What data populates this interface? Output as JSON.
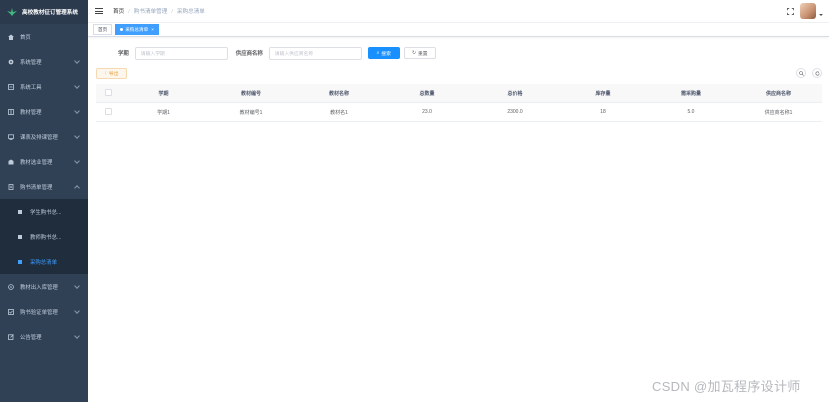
{
  "app": {
    "title": "高校教材征订管理系统"
  },
  "sidebar": {
    "items": [
      {
        "label": "首页",
        "icon": "home-icon"
      },
      {
        "label": "系统管理",
        "icon": "gear-icon",
        "expandable": true
      },
      {
        "label": "系统工具",
        "icon": "tool-icon",
        "expandable": true
      },
      {
        "label": "教材管理",
        "icon": "book-icon",
        "expandable": true
      },
      {
        "label": "课表及排课管理",
        "icon": "monitor-icon",
        "expandable": true
      },
      {
        "label": "教材选业管理",
        "icon": "building-icon",
        "expandable": true
      },
      {
        "label": "购书清单管理",
        "icon": "document-icon",
        "expandable": true,
        "expanded": true
      }
    ],
    "subitems": [
      {
        "label": "学生购书总...",
        "active": false
      },
      {
        "label": "教师购书总...",
        "active": false
      },
      {
        "label": "采购总清单",
        "active": true
      }
    ],
    "items_after": [
      {
        "label": "教材出入库管理",
        "icon": "warehouse-icon",
        "expandable": true
      },
      {
        "label": "购书验证单管理",
        "icon": "check-icon",
        "expandable": true
      },
      {
        "label": "公告管理",
        "icon": "edit-icon",
        "expandable": true
      }
    ]
  },
  "breadcrumb": {
    "home": "首页",
    "parent": "购书清单管理",
    "current": "采购总清单"
  },
  "tags": {
    "home": "首页",
    "current": "采购总清单"
  },
  "search": {
    "term_label": "学期",
    "term_placeholder": "请输入学期",
    "supplier_label": "供应商名称",
    "supplier_placeholder": "请输入供应商名称",
    "search_button": "搜索",
    "reset_button": "重置"
  },
  "toolbar": {
    "export_label": "导出"
  },
  "table": {
    "columns": [
      "学期",
      "教材编号",
      "教材名称",
      "总数量",
      "总价格",
      "库存量",
      "需采购量",
      "供应商名称"
    ],
    "rows": [
      [
        "学期1",
        "教材编号1",
        "教材名1",
        "23.0",
        "2300.0",
        "18",
        "5.0",
        "供应商名称1"
      ]
    ]
  },
  "watermark": "CSDN @加瓦程序设计师",
  "colors": {
    "sidebar": "#304156",
    "primary": "#1890ff",
    "active_tag": "#409eff",
    "warning": "#e6a23c"
  }
}
